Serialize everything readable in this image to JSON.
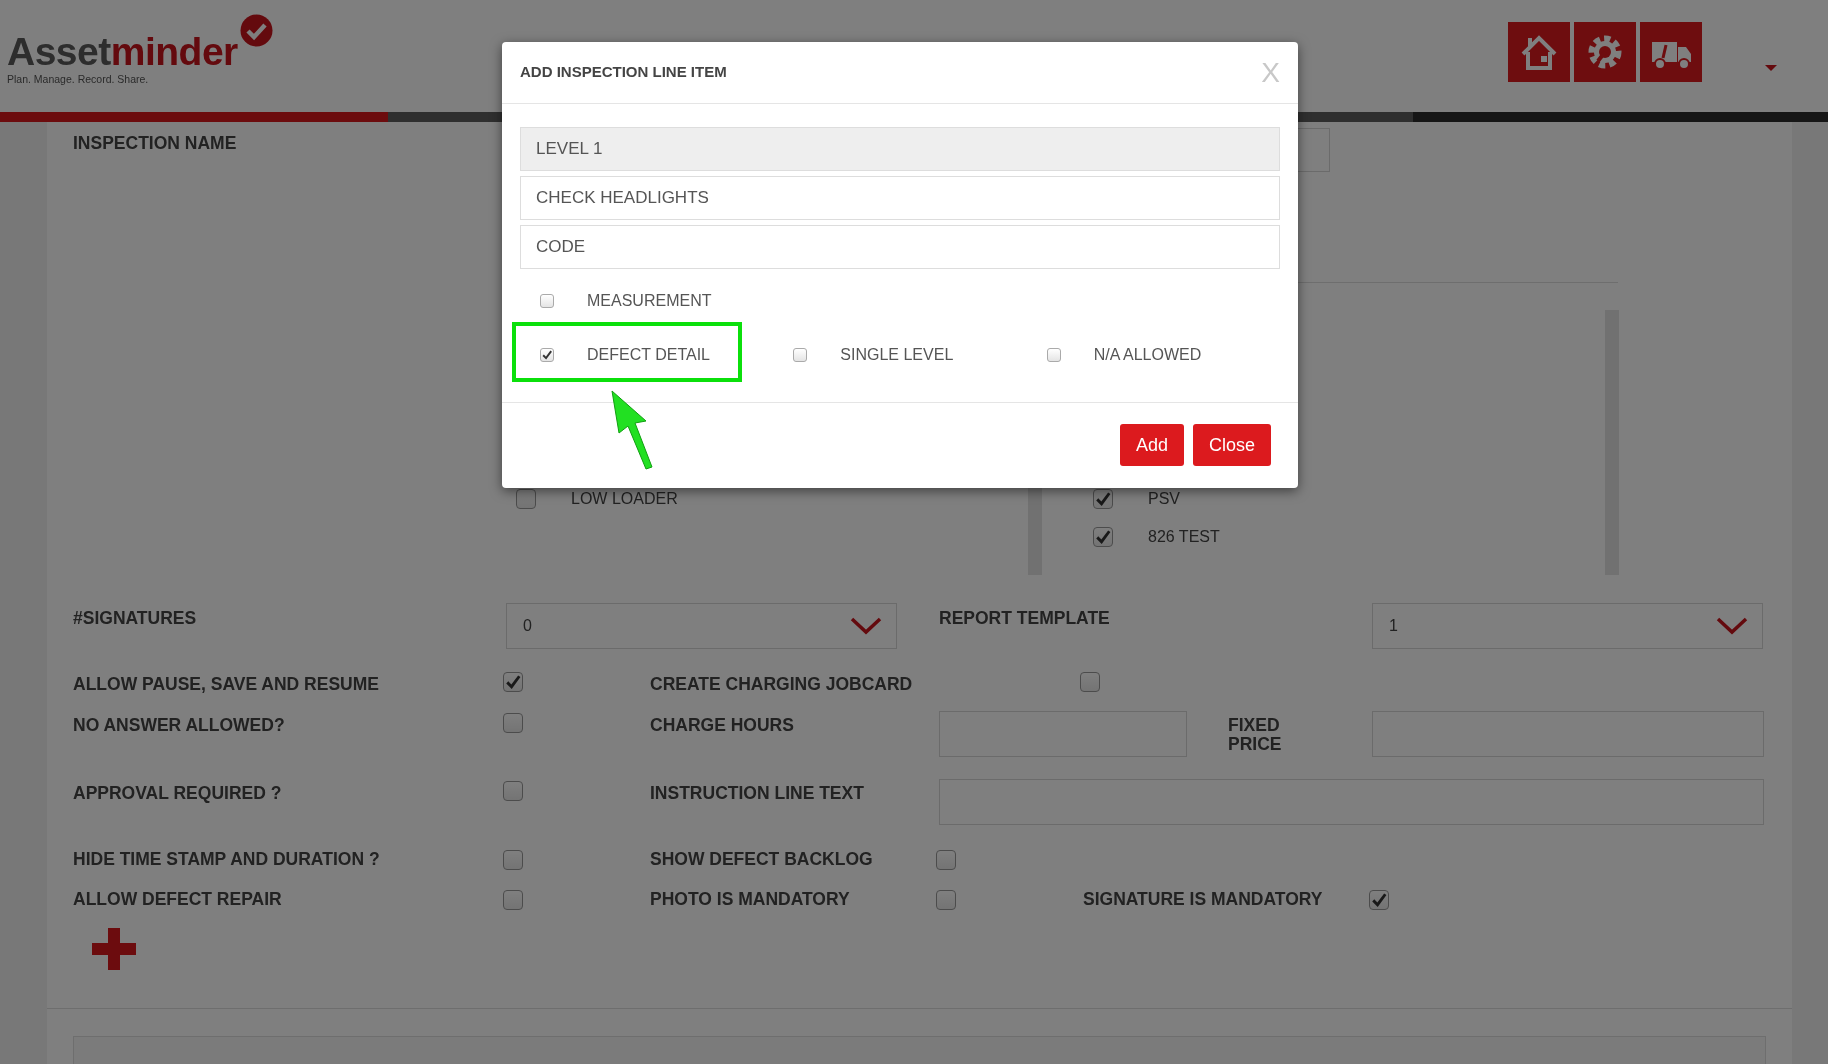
{
  "header": {
    "logo": {
      "part_dark": "Asset",
      "part_red": "minder",
      "tagline": "Plan. Manage. Record. Share."
    }
  },
  "page": {
    "inspection_name_label": "INSPECTION NAME",
    "list_left": [
      {
        "label": "LOW LOADER",
        "checked": false
      }
    ],
    "list_right": [
      {
        "label": "PSV",
        "checked": true
      },
      {
        "label": "826 TEST",
        "checked": true
      }
    ],
    "rows": [
      [
        {
          "kind": "label",
          "text": "#SIGNATURES"
        },
        {
          "kind": "select",
          "value": "0"
        },
        {
          "kind": "label",
          "text": "REPORT TEMPLATE"
        },
        {
          "kind": "select",
          "value": "1"
        }
      ],
      [
        {
          "kind": "label",
          "text": "ALLOW PAUSE, SAVE AND RESUME"
        },
        {
          "kind": "checkbox",
          "checked": true
        },
        {
          "kind": "label",
          "text": "CREATE CHARGING JOBCARD"
        },
        {
          "kind": "checkbox",
          "checked": false
        }
      ],
      [
        {
          "kind": "label",
          "text": "NO ANSWER ALLOWED?"
        },
        {
          "kind": "checkbox",
          "checked": false
        },
        {
          "kind": "label",
          "text": "CHARGE HOURS"
        },
        {
          "kind": "input"
        },
        {
          "kind": "label",
          "text": "FIXED PRICE"
        },
        {
          "kind": "input"
        }
      ],
      [
        {
          "kind": "label",
          "text": "APPROVAL REQUIRED ?"
        },
        {
          "kind": "checkbox",
          "checked": false
        },
        {
          "kind": "label",
          "text": "INSTRUCTION LINE TEXT"
        },
        {
          "kind": "input"
        }
      ],
      [
        {
          "kind": "label",
          "text": "HIDE TIME STAMP AND DURATION ?"
        },
        {
          "kind": "checkbox",
          "checked": false
        },
        {
          "kind": "label",
          "text": "SHOW DEFECT BACKLOG"
        },
        {
          "kind": "checkbox",
          "checked": false
        }
      ],
      [
        {
          "kind": "label",
          "text": "ALLOW DEFECT REPAIR"
        },
        {
          "kind": "checkbox",
          "checked": false
        },
        {
          "kind": "label",
          "text": "PHOTO IS MANDATORY"
        },
        {
          "kind": "checkbox",
          "checked": false
        },
        {
          "kind": "label",
          "text": "SIGNATURE IS MANDATORY"
        },
        {
          "kind": "checkbox",
          "checked": true
        }
      ]
    ]
  },
  "modal": {
    "title": "ADD INSPECTION LINE ITEM",
    "close_glyph": "X",
    "fields": [
      {
        "value": "LEVEL 1",
        "disabled": true
      },
      {
        "value": "CHECK HEADLIGHTS",
        "disabled": false
      },
      {
        "placeholder": "CODE",
        "disabled": false
      }
    ],
    "option_rows": [
      [
        {
          "label": "MEASUREMENT",
          "checked": false,
          "highlighted": false
        }
      ],
      [
        {
          "label": "DEFECT DETAIL",
          "checked": true,
          "highlighted": true
        },
        {
          "label": "SINGLE LEVEL",
          "checked": false,
          "highlighted": false
        },
        {
          "label": "N/A ALLOWED",
          "checked": false,
          "highlighted": false
        }
      ]
    ],
    "buttons": [
      "Add",
      "Close"
    ]
  }
}
